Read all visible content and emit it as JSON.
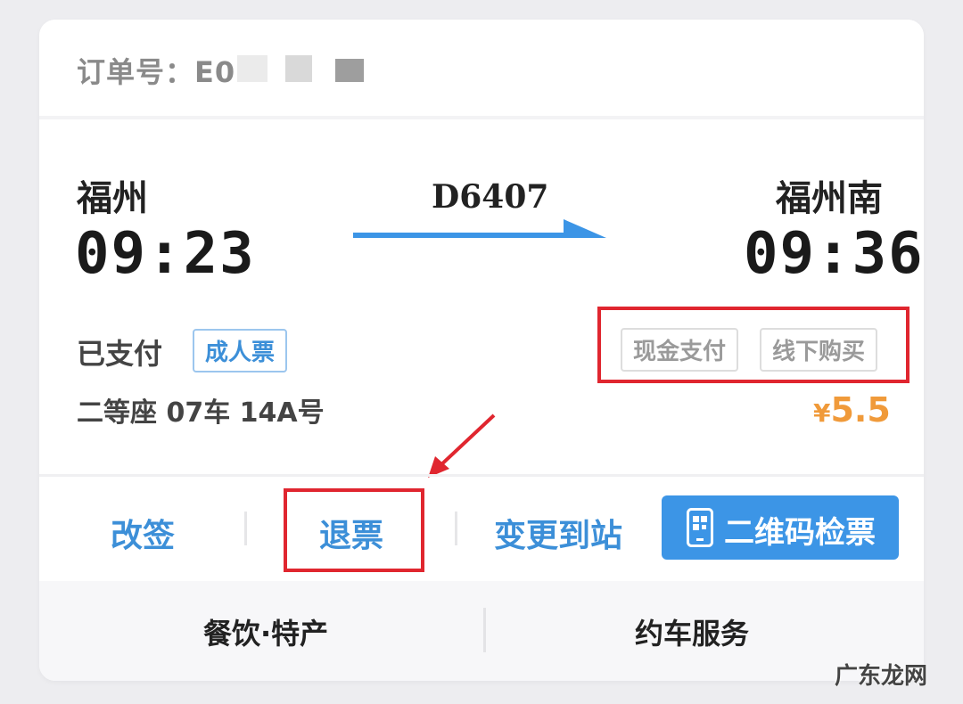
{
  "order": {
    "label": "订单号：E0"
  },
  "trip": {
    "from_station": "福州",
    "from_time": "09:23",
    "to_station": "福州南",
    "to_time": "09:36",
    "train_no": "D6407"
  },
  "ticket": {
    "status": "已支付",
    "type_tag": "成人票",
    "seat": "二等座 07车 14A号",
    "chips": [
      "现金支付",
      "线下购买"
    ],
    "price_currency": "¥",
    "price_amount": "5.5"
  },
  "actions": {
    "change": "改签",
    "refund": "退票",
    "change_station": "变更到站",
    "qr_check": "二维码检票"
  },
  "bottom": {
    "food": "餐饮·特产",
    "car": "约车服务"
  },
  "watermark": "广东龙网",
  "colors": {
    "accent_blue": "#3c95e6",
    "link_blue": "#3c8fd8",
    "price_orange": "#f09a3a",
    "highlight_red": "#e0262f"
  },
  "icons": [
    "qr-phone-icon",
    "arrow-right-icon",
    "red-pointer-arrow-icon"
  ]
}
